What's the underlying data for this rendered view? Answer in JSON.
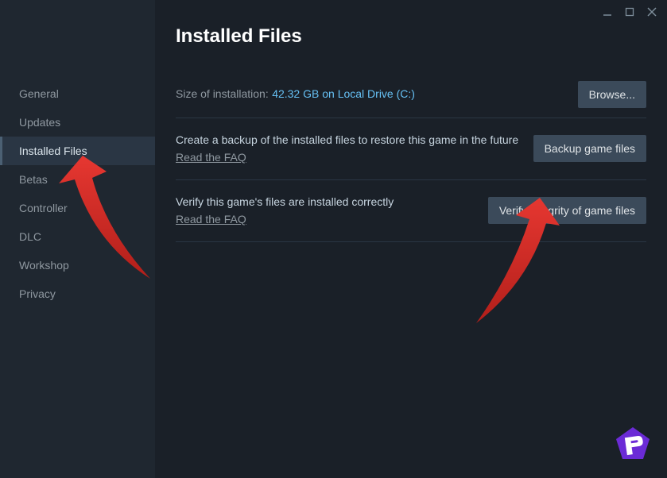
{
  "sidebar": {
    "items": [
      {
        "label": "General"
      },
      {
        "label": "Updates"
      },
      {
        "label": "Installed Files"
      },
      {
        "label": "Betas"
      },
      {
        "label": "Controller"
      },
      {
        "label": "DLC"
      },
      {
        "label": "Workshop"
      },
      {
        "label": "Privacy"
      }
    ],
    "activeIndex": 2
  },
  "main": {
    "title": "Installed Files",
    "size_label": "Size of installation:",
    "size_value": "42.32 GB on Local Drive (C:)",
    "browse_label": "Browse...",
    "backup": {
      "desc": "Create a backup of the installed files to restore this game in the future",
      "faq": "Read the FAQ",
      "button": "Backup game files"
    },
    "verify": {
      "desc": "Verify this game's files are installed correctly",
      "faq": "Read the FAQ",
      "button": "Verify integrity of game files"
    }
  }
}
